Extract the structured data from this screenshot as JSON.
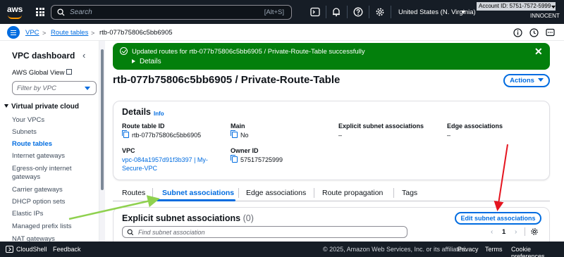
{
  "topnav": {
    "logo_text": "aws",
    "search_placeholder": "Search",
    "search_shortcut": "[Alt+S]",
    "region": "United States (N. Virginia)",
    "account": "Account ID: 5751-7572-5999",
    "user": "INNOCENT"
  },
  "breadcrumb": {
    "items": [
      "VPC",
      "Route tables",
      "rtb-077b75806c5bb6905"
    ]
  },
  "sidebar": {
    "title": "VPC dashboard",
    "global_view": "AWS Global View",
    "filter_placeholder": "Filter by VPC",
    "section": "Virtual private cloud",
    "items": [
      {
        "label": "Your VPCs"
      },
      {
        "label": "Subnets"
      },
      {
        "label": "Route tables"
      },
      {
        "label": "Internet gateways"
      },
      {
        "label": "Egress-only internet gateways"
      },
      {
        "label": "Carrier gateways"
      },
      {
        "label": "DHCP option sets"
      },
      {
        "label": "Elastic IPs"
      },
      {
        "label": "Managed prefix lists"
      },
      {
        "label": "NAT gateways"
      }
    ]
  },
  "flash": {
    "message": "Updated routes for rtb-077b75806c5bb6905 / Private-Route-Table successfully",
    "details": "Details",
    "close": "✕"
  },
  "page": {
    "title": "rtb-077b75806c5bb6905 / Private-Route-Table",
    "actions": "Actions"
  },
  "details": {
    "title": "Details",
    "info": "Info",
    "route_table_id_label": "Route table ID",
    "route_table_id": "rtb-077b75806c5bb6905",
    "main_label": "Main",
    "main": "No",
    "explicit_label": "Explicit subnet associations",
    "explicit": "–",
    "edge_label": "Edge associations",
    "edge": "–",
    "vpc_label": "VPC",
    "vpc_line1": "vpc-084a1957d91f3b397 | My-",
    "vpc_line2": "Secure-VPC",
    "owner_label": "Owner ID",
    "owner": "575175725999"
  },
  "tabs": [
    {
      "label": "Routes"
    },
    {
      "label": "Subnet associations"
    },
    {
      "label": "Edge associations"
    },
    {
      "label": "Route propagation"
    },
    {
      "label": "Tags"
    }
  ],
  "panel": {
    "title": "Explicit subnet associations",
    "count": "(0)",
    "edit": "Edit subnet associations",
    "find_placeholder": "Find subnet association",
    "page": "1"
  },
  "footer": {
    "cloudshell": "CloudShell",
    "feedback": "Feedback",
    "copyright": "© 2025, Amazon Web Services, Inc. or its affiliates.",
    "privacy": "Privacy",
    "terms": "Terms",
    "cookies": "Cookie preferences"
  },
  "colors": {
    "accent": "#006ce0",
    "success": "#037f0c",
    "nav": "#161d26",
    "annotation_green": "#8fd14f",
    "annotation_red": "#e5141f"
  }
}
